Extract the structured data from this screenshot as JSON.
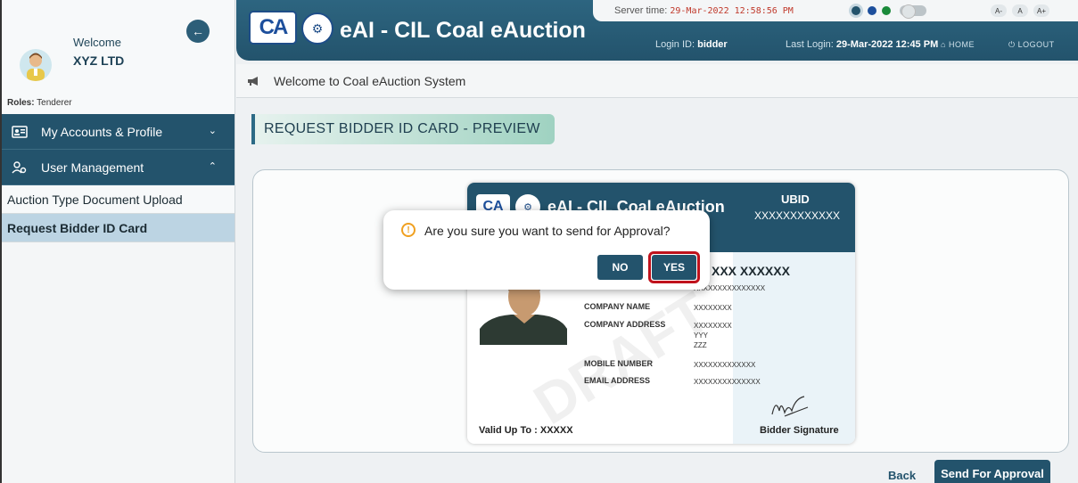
{
  "sidebar": {
    "welcome": "Welcome",
    "company": "XYZ LTD",
    "roles_label": "Roles:",
    "roles_value": "Tenderer",
    "menu": [
      {
        "label": "My Accounts & Profile",
        "icon": "id-card-icon"
      },
      {
        "label": "User Management",
        "icon": "users-gear-icon"
      }
    ],
    "submenu": [
      {
        "label": "Auction Type Document Upload"
      },
      {
        "label": "Request Bidder ID Card"
      }
    ]
  },
  "header": {
    "logo": "CA",
    "title": "eAI - CIL Coal eAuction",
    "server_time_label": "Server time:",
    "server_time": "29-Mar-2022 12:58:56 PM",
    "font_controls": [
      "A-",
      "A",
      "A+"
    ],
    "login_id_label": "Login ID:",
    "login_id": "bidder",
    "last_login_label": "Last Login:",
    "last_login": "29-Mar-2022 12:45 PM",
    "home": "HOME",
    "logout": "LOGOUT",
    "theme_colors": [
      "#23536c",
      "#1d4f9c",
      "#1a8a3a"
    ]
  },
  "welcome_bar": {
    "text": "Welcome to Coal eAuction System"
  },
  "page": {
    "title": "REQUEST BIDDER ID CARD - PREVIEW"
  },
  "id_card": {
    "title": "eAI - CIL Coal eAuction",
    "ubid_label": "UBID",
    "ubid_value": "XXXXXXXXXXXX",
    "name": "XXX XXXXXX",
    "sub": "XXXXXXXXXXXXXXX",
    "fields": [
      {
        "label": "COMPANY NAME",
        "value": "XXXXXXXX"
      },
      {
        "label": "COMPANY ADDRESS",
        "value": "XXXXXXXX\nYYY\nZZZ"
      },
      {
        "label": "MOBILE NUMBER",
        "value": "XXXXXXXXXXXXX"
      },
      {
        "label": "EMAIL ADDRESS",
        "value": "XXXXXXXXXXXXXX"
      }
    ],
    "valid": "Valid Up To : XXXXX",
    "signature_label": "Bidder Signature"
  },
  "footer": {
    "back": "Back",
    "send": "Send For Approval"
  },
  "modal": {
    "message": "Are you sure you want to send for Approval?",
    "no": "NO",
    "yes": "YES"
  }
}
